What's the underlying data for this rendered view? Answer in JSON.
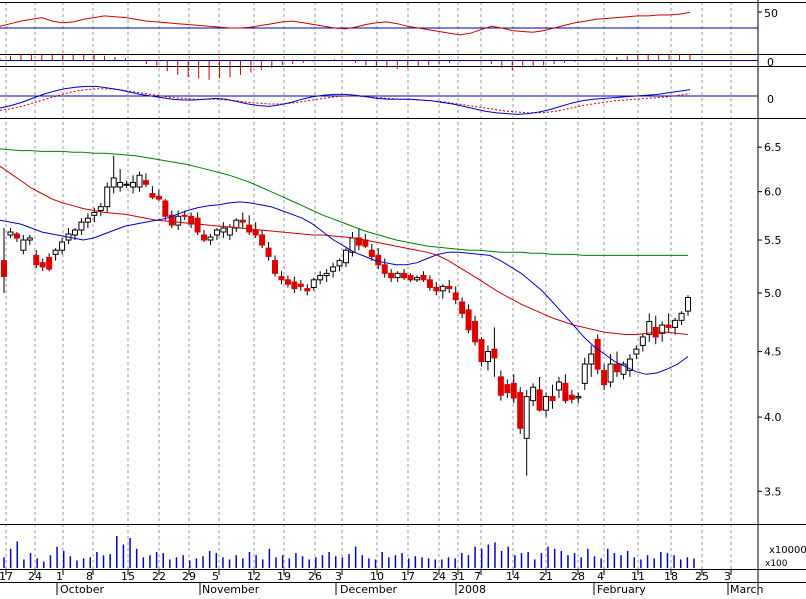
{
  "colors": {
    "background": "#ffffff",
    "grid": "#9a9a9a",
    "rsi_line": "#cc0000",
    "ref_line": "#0000aa",
    "histogram": "#cc0000",
    "macd_line": "#0000cc",
    "signal_line": "#cc0000",
    "ma_short": "#0000cc",
    "ma_mid": "#cc0000",
    "ma_long": "#008000",
    "candle_up": "#ffffff",
    "candle_down": "#dd0000",
    "volume": "#0000cc"
  },
  "panel_labels": {
    "rsi": "50",
    "histogram": "0",
    "macd": "0",
    "volume_unit": "x10000",
    "volume_scale": "x100"
  },
  "chart_data": {
    "type": "candlestick",
    "title": "",
    "xlabel": "",
    "ylabel": "",
    "price_axis_ticks": [
      "6.5",
      "6.0",
      "5.5",
      "5.0",
      "4.5",
      "4.0",
      "3.5"
    ],
    "ylim": [
      3.3,
      6.85
    ],
    "y_scale": "log",
    "date_ticks": [
      "17",
      "24",
      "1",
      "8",
      "15",
      "22",
      "29",
      "5",
      "12",
      "19",
      "26",
      "3",
      "10",
      "17",
      "24",
      "31",
      "7",
      "14",
      "21",
      "28",
      "4",
      "11",
      "18",
      "25",
      "3"
    ],
    "month_labels": [
      "October",
      "November",
      "December",
      "2008",
      "February",
      "March"
    ],
    "grid": "vertical dotted at weekly ticks",
    "candles_ohlc": [
      [
        5.3,
        5.62,
        5.0,
        5.15
      ],
      [
        5.55,
        5.62,
        5.52,
        5.58
      ],
      [
        5.56,
        5.58,
        5.48,
        5.52
      ],
      [
        5.4,
        5.55,
        5.36,
        5.5
      ],
      [
        5.5,
        5.55,
        5.45,
        5.52
      ],
      [
        5.35,
        5.4,
        5.23,
        5.26
      ],
      [
        5.28,
        5.32,
        5.2,
        5.24
      ],
      [
        5.33,
        5.37,
        5.2,
        5.22
      ],
      [
        5.36,
        5.42,
        5.3,
        5.4
      ],
      [
        5.4,
        5.52,
        5.36,
        5.48
      ],
      [
        5.5,
        5.62,
        5.46,
        5.56
      ],
      [
        5.55,
        5.62,
        5.5,
        5.6
      ],
      [
        5.6,
        5.72,
        5.55,
        5.68
      ],
      [
        5.68,
        5.77,
        5.62,
        5.72
      ],
      [
        5.75,
        5.83,
        5.68,
        5.78
      ],
      [
        5.8,
        5.88,
        5.74,
        5.84
      ],
      [
        5.84,
        6.1,
        5.78,
        6.05
      ],
      [
        6.05,
        6.4,
        5.98,
        6.15
      ],
      [
        6.05,
        6.25,
        6.0,
        6.1
      ],
      [
        6.08,
        6.12,
        6.04,
        6.08
      ],
      [
        6.05,
        6.18,
        5.98,
        6.1
      ],
      [
        6.05,
        6.22,
        6.0,
        6.18
      ],
      [
        6.12,
        6.2,
        6.05,
        6.08
      ],
      [
        5.98,
        6.06,
        5.92,
        5.94
      ],
      [
        5.95,
        6.02,
        5.9,
        5.92
      ],
      [
        5.9,
        5.92,
        5.7,
        5.74
      ],
      [
        5.75,
        5.8,
        5.62,
        5.65
      ],
      [
        5.65,
        5.8,
        5.6,
        5.74
      ],
      [
        5.75,
        5.8,
        5.7,
        5.74
      ],
      [
        5.74,
        5.78,
        5.62,
        5.66
      ],
      [
        5.72,
        5.78,
        5.55,
        5.58
      ],
      [
        5.55,
        5.6,
        5.48,
        5.5
      ],
      [
        5.5,
        5.56,
        5.45,
        5.53
      ],
      [
        5.55,
        5.62,
        5.5,
        5.6
      ],
      [
        5.58,
        5.68,
        5.52,
        5.62
      ],
      [
        5.55,
        5.66,
        5.5,
        5.63
      ],
      [
        5.62,
        5.72,
        5.58,
        5.7
      ],
      [
        5.7,
        5.78,
        5.62,
        5.68
      ],
      [
        5.65,
        5.75,
        5.55,
        5.58
      ],
      [
        5.6,
        5.68,
        5.52,
        5.55
      ],
      [
        5.55,
        5.6,
        5.42,
        5.45
      ],
      [
        5.42,
        5.48,
        5.3,
        5.34
      ],
      [
        5.3,
        5.35,
        5.15,
        5.18
      ],
      [
        5.15,
        5.2,
        5.08,
        5.12
      ],
      [
        5.12,
        5.16,
        5.05,
        5.08
      ],
      [
        5.1,
        5.15,
        5.0,
        5.04
      ],
      [
        5.08,
        5.12,
        5.02,
        5.06
      ],
      [
        5.04,
        5.08,
        4.98,
        5.02
      ],
      [
        5.05,
        5.14,
        5.02,
        5.12
      ],
      [
        5.12,
        5.2,
        5.08,
        5.16
      ],
      [
        5.16,
        5.22,
        5.1,
        5.18
      ],
      [
        5.2,
        5.28,
        5.14,
        5.24
      ],
      [
        5.25,
        5.32,
        5.2,
        5.3
      ],
      [
        5.28,
        5.42,
        5.24,
        5.4
      ],
      [
        5.38,
        5.58,
        5.34,
        5.52
      ],
      [
        5.52,
        5.62,
        5.4,
        5.45
      ],
      [
        5.5,
        5.56,
        5.42,
        5.44
      ],
      [
        5.4,
        5.46,
        5.3,
        5.34
      ],
      [
        5.35,
        5.42,
        5.22,
        5.26
      ],
      [
        5.26,
        5.32,
        5.14,
        5.18
      ],
      [
        5.18,
        5.22,
        5.1,
        5.14
      ],
      [
        5.14,
        5.2,
        5.1,
        5.18
      ],
      [
        5.18,
        5.22,
        5.12,
        5.14
      ],
      [
        5.16,
        5.18,
        5.1,
        5.12
      ],
      [
        5.12,
        5.16,
        5.1,
        5.14
      ],
      [
        5.16,
        5.2,
        5.1,
        5.12
      ],
      [
        5.12,
        5.16,
        5.02,
        5.05
      ],
      [
        5.05,
        5.1,
        4.98,
        5.02
      ],
      [
        5.02,
        5.08,
        4.95,
        5.06
      ],
      [
        5.06,
        5.12,
        5.0,
        5.04
      ],
      [
        5.0,
        5.06,
        4.9,
        4.94
      ],
      [
        4.92,
        4.96,
        4.78,
        4.82
      ],
      [
        4.85,
        4.9,
        4.65,
        4.68
      ],
      [
        4.75,
        4.8,
        4.55,
        4.58
      ],
      [
        4.6,
        4.62,
        4.38,
        4.42
      ],
      [
        4.42,
        4.55,
        4.35,
        4.5
      ],
      [
        4.52,
        4.7,
        4.3,
        4.45
      ],
      [
        4.3,
        4.35,
        4.12,
        4.16
      ],
      [
        4.24,
        4.28,
        4.14,
        4.18
      ],
      [
        4.25,
        4.32,
        4.1,
        4.14
      ],
      [
        4.18,
        4.22,
        3.88,
        3.92
      ],
      [
        3.85,
        4.2,
        3.6,
        4.15
      ],
      [
        4.12,
        4.25,
        4.08,
        4.22
      ],
      [
        4.2,
        4.3,
        4.04,
        4.05
      ],
      [
        4.05,
        4.18,
        4.0,
        4.15
      ],
      [
        4.15,
        4.24,
        4.06,
        4.12
      ],
      [
        4.2,
        4.3,
        4.14,
        4.26
      ],
      [
        4.25,
        4.32,
        4.1,
        4.12
      ],
      [
        4.16,
        4.2,
        4.1,
        4.13
      ],
      [
        4.14,
        4.18,
        4.1,
        4.15
      ],
      [
        4.25,
        4.45,
        4.2,
        4.4
      ],
      [
        4.4,
        4.55,
        4.3,
        4.48
      ],
      [
        4.6,
        4.64,
        4.32,
        4.36
      ],
      [
        4.35,
        4.4,
        4.2,
        4.24
      ],
      [
        4.26,
        4.48,
        4.22,
        4.4
      ],
      [
        4.4,
        4.5,
        4.3,
        4.34
      ],
      [
        4.32,
        4.42,
        4.28,
        4.4
      ],
      [
        4.35,
        4.48,
        4.3,
        4.44
      ],
      [
        4.48,
        4.55,
        4.44,
        4.52
      ],
      [
        4.55,
        4.65,
        4.5,
        4.62
      ],
      [
        4.64,
        4.82,
        4.58,
        4.75
      ],
      [
        4.7,
        4.8,
        4.56,
        4.62
      ],
      [
        4.65,
        4.75,
        4.58,
        4.72
      ],
      [
        4.72,
        4.82,
        4.66,
        4.7
      ],
      [
        4.7,
        4.78,
        4.64,
        4.76
      ],
      [
        4.76,
        4.84,
        4.72,
        4.82
      ],
      [
        4.84,
        4.98,
        4.8,
        4.96
      ]
    ],
    "series": [
      {
        "role": "ma_short",
        "values": [
          5.7,
          5.68,
          5.66,
          5.62,
          5.58,
          5.56,
          5.54,
          5.52,
          5.5,
          5.52,
          5.56,
          5.6,
          5.64,
          5.66,
          5.68,
          5.7,
          5.72,
          5.76,
          5.8,
          5.83,
          5.85,
          5.86,
          5.88,
          5.89,
          5.88,
          5.86,
          5.84,
          5.8,
          5.76,
          5.72,
          5.66,
          5.58,
          5.5,
          5.44,
          5.38,
          5.34,
          5.3,
          5.28,
          5.26,
          5.26,
          5.28,
          5.32,
          5.36,
          5.38,
          5.38,
          5.37,
          5.36,
          5.35,
          5.3,
          5.24,
          5.18,
          5.1,
          5.02,
          4.92,
          4.82,
          4.72,
          4.62,
          4.54,
          4.48,
          4.42,
          4.38,
          4.34,
          4.32,
          4.33,
          4.36,
          4.4,
          4.46
        ]
      },
      {
        "role": "ma_mid",
        "values": [
          6.28,
          6.2,
          6.12,
          6.04,
          5.98,
          5.92,
          5.88,
          5.85,
          5.82,
          5.8,
          5.78,
          5.77,
          5.76,
          5.74,
          5.72,
          5.7,
          5.69,
          5.68,
          5.67,
          5.66,
          5.65,
          5.64,
          5.63,
          5.62,
          5.61,
          5.6,
          5.59,
          5.58,
          5.57,
          5.56,
          5.55,
          5.55,
          5.54,
          5.53,
          5.52,
          5.5,
          5.48,
          5.46,
          5.44,
          5.42,
          5.4,
          5.38,
          5.35,
          5.3,
          5.24,
          5.18,
          5.12,
          5.06,
          5.0,
          4.95,
          4.9,
          4.86,
          4.82,
          4.78,
          4.75,
          4.72,
          4.7,
          4.68,
          4.66,
          4.65,
          4.64,
          4.64,
          4.65,
          4.66,
          4.66,
          4.65,
          4.64
        ]
      },
      {
        "role": "ma_long",
        "values": [
          6.48,
          6.47,
          6.46,
          6.46,
          6.45,
          6.45,
          6.45,
          6.44,
          6.44,
          6.43,
          6.43,
          6.42,
          6.41,
          6.4,
          6.38,
          6.36,
          6.34,
          6.32,
          6.3,
          6.27,
          6.24,
          6.21,
          6.18,
          6.14,
          6.1,
          6.05,
          6.0,
          5.95,
          5.9,
          5.85,
          5.8,
          5.75,
          5.71,
          5.67,
          5.63,
          5.59,
          5.56,
          5.53,
          5.5,
          5.48,
          5.46,
          5.44,
          5.43,
          5.42,
          5.41,
          5.4,
          5.4,
          5.39,
          5.38,
          5.38,
          5.38,
          5.37,
          5.37,
          5.36,
          5.36,
          5.36,
          5.35,
          5.35,
          5.35,
          5.35,
          5.35,
          5.35,
          5.35,
          5.35,
          5.35,
          5.35,
          5.35
        ]
      },
      {
        "role": "rsi",
        "values": [
          52,
          55,
          58,
          60,
          62,
          58,
          56,
          57,
          60,
          62,
          64,
          63,
          62,
          60,
          58,
          57,
          56,
          55,
          54,
          53,
          52,
          51,
          50,
          50,
          51,
          53,
          55,
          57,
          58,
          56,
          54,
          52,
          50,
          49,
          51,
          54,
          56,
          57,
          55,
          52,
          50,
          48,
          46,
          44,
          42,
          44,
          48,
          52,
          50,
          47,
          46,
          45,
          47,
          50,
          53,
          56,
          58,
          60,
          61,
          62,
          63,
          64,
          64,
          65,
          65,
          66,
          68
        ]
      },
      {
        "role": "histogram",
        "values": [
          0.2,
          0.4,
          0.6,
          0.8,
          1.0,
          1.2,
          1.0,
          0.8,
          0.6,
          0.5,
          0.4,
          0.3,
          0.2,
          0.0,
          -0.3,
          -0.6,
          -0.9,
          -1.2,
          -1.4,
          -1.5,
          -1.6,
          -1.5,
          -1.4,
          -1.2,
          -1.0,
          -0.8,
          -0.6,
          -0.4,
          -0.3,
          -0.2,
          -0.1,
          0.0,
          0.1,
          0.0,
          -0.2,
          -0.4,
          -0.5,
          -0.6,
          -0.7,
          -0.6,
          -0.5,
          -0.4,
          -0.3,
          -0.2,
          -0.1,
          0.0,
          -0.1,
          -0.3,
          -0.6,
          -0.8,
          -0.6,
          -0.5,
          -0.4,
          -0.3,
          -0.2,
          -0.1,
          0.0,
          0.1,
          0.2,
          0.3,
          0.4,
          0.5,
          0.6,
          0.7,
          0.8,
          0.9,
          1.0
        ]
      },
      {
        "role": "macd",
        "values": [
          -0.15,
          -0.12,
          -0.08,
          -0.03,
          0.02,
          0.06,
          0.09,
          0.11,
          0.12,
          0.12,
          0.1,
          0.08,
          0.05,
          0.02,
          0.0,
          -0.02,
          -0.04,
          -0.05,
          -0.05,
          -0.04,
          -0.03,
          -0.04,
          -0.07,
          -0.1,
          -0.12,
          -0.13,
          -0.11,
          -0.08,
          -0.04,
          -0.01,
          0.01,
          0.02,
          0.02,
          0.01,
          -0.01,
          -0.03,
          -0.04,
          -0.04,
          -0.04,
          -0.05,
          -0.06,
          -0.08,
          -0.1,
          -0.13,
          -0.16,
          -0.19,
          -0.21,
          -0.22,
          -0.23,
          -0.22,
          -0.2,
          -0.17,
          -0.13,
          -0.09,
          -0.06,
          -0.04,
          -0.03,
          -0.02,
          -0.01,
          0.0,
          0.01,
          0.02,
          0.04,
          0.06,
          0.08
        ]
      },
      {
        "role": "signal",
        "values": [
          -0.18,
          -0.16,
          -0.13,
          -0.09,
          -0.05,
          -0.01,
          0.03,
          0.06,
          0.08,
          0.09,
          0.09,
          0.08,
          0.06,
          0.04,
          0.02,
          0.0,
          -0.02,
          -0.03,
          -0.04,
          -0.04,
          -0.04,
          -0.05,
          -0.06,
          -0.08,
          -0.09,
          -0.1,
          -0.1,
          -0.09,
          -0.07,
          -0.05,
          -0.03,
          -0.01,
          0.0,
          0.0,
          -0.01,
          -0.02,
          -0.03,
          -0.04,
          -0.04,
          -0.05,
          -0.06,
          -0.07,
          -0.09,
          -0.11,
          -0.13,
          -0.15,
          -0.17,
          -0.19,
          -0.2,
          -0.21,
          -0.21,
          -0.2,
          -0.18,
          -0.15,
          -0.12,
          -0.1,
          -0.08,
          -0.06,
          -0.05,
          -0.04,
          -0.03,
          -0.02,
          -0.01,
          0.01,
          0.03
        ]
      },
      {
        "role": "volume",
        "values": [
          10,
          18,
          25,
          8,
          14,
          9,
          6,
          12,
          20,
          16,
          11,
          7,
          9,
          10,
          15,
          12,
          13,
          30,
          22,
          28,
          18,
          10,
          12,
          15,
          14,
          8,
          10,
          12,
          7,
          9,
          11,
          16,
          14,
          10,
          8,
          12,
          9,
          15,
          12,
          8,
          18,
          10,
          12,
          9,
          14,
          11,
          8,
          10,
          12,
          15,
          11,
          10,
          13,
          20,
          12,
          9,
          8,
          15,
          10,
          12,
          14,
          9,
          11,
          10,
          9,
          8,
          8,
          10,
          9,
          14,
          12,
          20,
          18,
          22,
          24,
          16,
          20,
          12,
          14,
          15,
          8,
          14,
          20,
          18,
          16,
          12,
          14,
          10,
          18,
          11,
          9,
          18,
          14,
          12,
          16,
          10,
          8,
          12,
          9,
          15,
          14,
          12,
          8,
          10,
          9
        ]
      }
    ]
  }
}
